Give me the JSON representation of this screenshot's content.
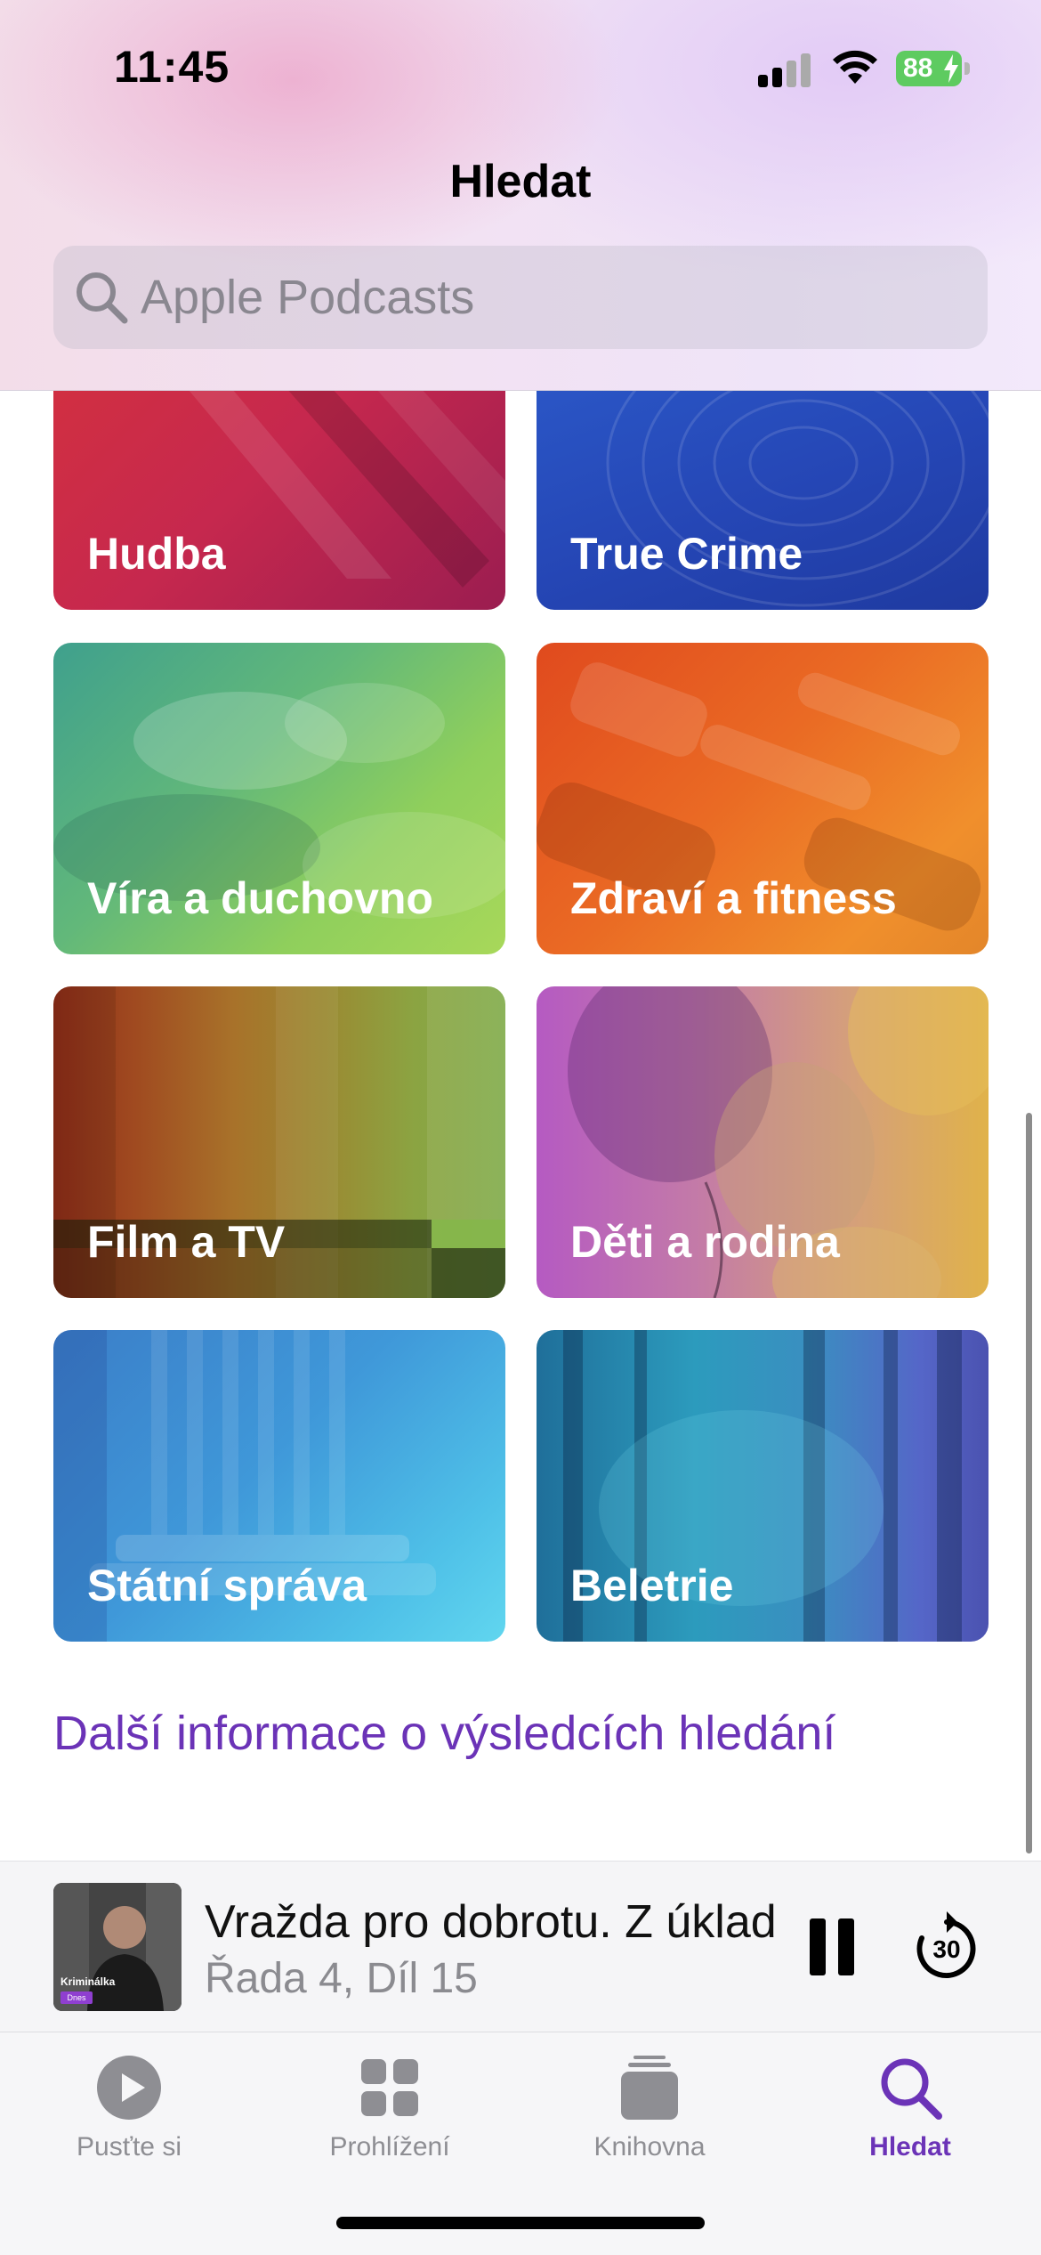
{
  "status_bar": {
    "time": "11:45",
    "battery": "88"
  },
  "header": {
    "title": "Hledat",
    "search": {
      "placeholder": "Apple Podcasts",
      "value": ""
    }
  },
  "categories": [
    {
      "label": "Hudba"
    },
    {
      "label": "True Crime"
    },
    {
      "label": "Víra a duchovno"
    },
    {
      "label": "Zdraví a fitness"
    },
    {
      "label": "Film a TV"
    },
    {
      "label": "Děti a rodina"
    },
    {
      "label": "Státní správa"
    },
    {
      "label": "Beletrie"
    }
  ],
  "more_info_link": "Další informace o výsledcích hledání",
  "mini_player": {
    "title": "Vražda pro dobrotu. Z úklad",
    "subtitle": "Řada 4, Díl 15",
    "artwork_text": "Kriminálka",
    "artwork_badge": "Dnes",
    "skip_seconds": "30"
  },
  "tabs": [
    {
      "label": "Pusťte si",
      "icon": "play-circle-icon"
    },
    {
      "label": "Prohlížení",
      "icon": "grid-icon"
    },
    {
      "label": "Knihovna",
      "icon": "stack-icon"
    },
    {
      "label": "Hledat",
      "icon": "search-icon",
      "active": true
    }
  ],
  "colors": {
    "accent": "#6b33b7"
  }
}
